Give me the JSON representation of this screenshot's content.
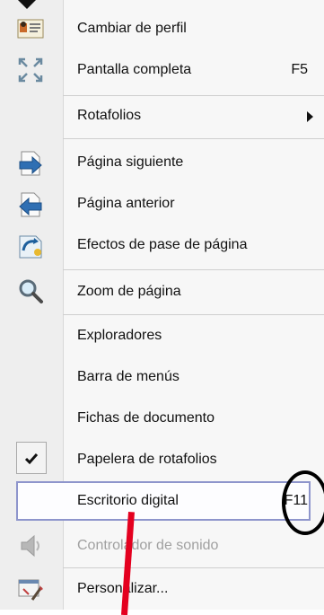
{
  "menu": {
    "items": [
      {
        "label": "Cambiar de perfil",
        "icon": "profile-card-icon"
      },
      {
        "label": "Pantalla completa",
        "shortcut": "F5",
        "icon": "fullscreen-icon"
      },
      {
        "label": "Rotafolios",
        "icon": "submenu-arrow-icon"
      },
      {
        "label": "Página siguiente",
        "icon": "next-page-icon"
      },
      {
        "label": "Página anterior",
        "icon": "previous-page-icon"
      },
      {
        "label": "Efectos de pase de página",
        "icon": "page-effects-icon"
      },
      {
        "label": "Zoom de página",
        "icon": "magnifier-icon"
      },
      {
        "label": "Exploradores"
      },
      {
        "label": "Barra de menús"
      },
      {
        "label": "Fichas de documento"
      },
      {
        "label": "Papelera de rotafolios",
        "checked": true,
        "icon": "checkmark-icon"
      },
      {
        "label": "Escritorio digital",
        "shortcut": "F11",
        "highlighted": true
      },
      {
        "label": "Controlador de sonido",
        "disabled": true,
        "icon": "speaker-icon"
      },
      {
        "label": "Personalizar...",
        "icon": "customize-icon"
      }
    ]
  },
  "colors": {
    "highlight_border": "#8e95cc",
    "annotation_red": "#e4001f",
    "annotation_black": "#000000"
  }
}
